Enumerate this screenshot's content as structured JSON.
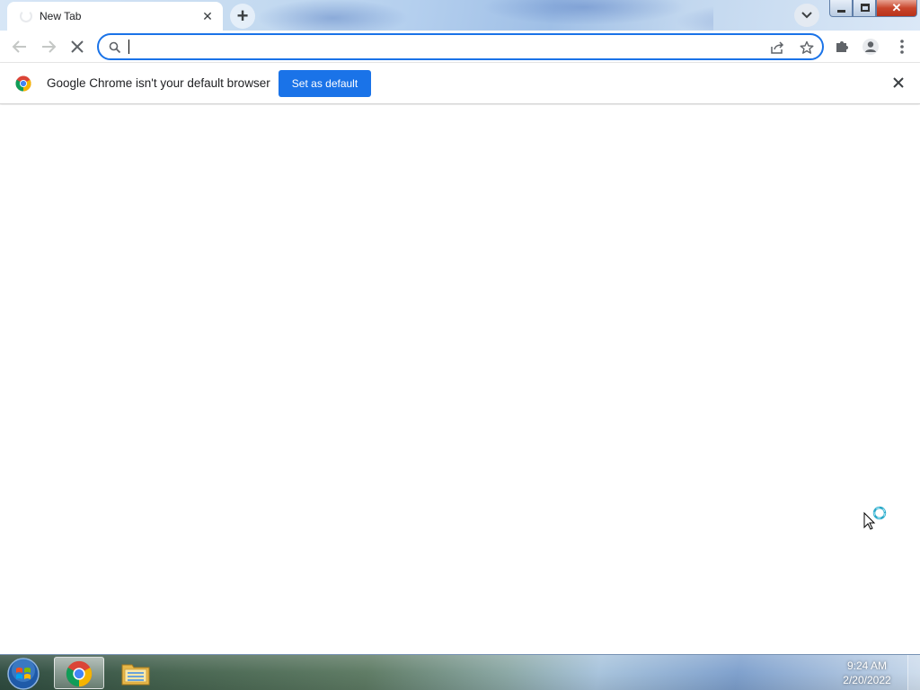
{
  "tab": {
    "title": "New Tab",
    "close_glyph": "✕"
  },
  "newtab": {
    "glyph": "+"
  },
  "window_controls": {
    "close_glyph": "✕"
  },
  "omnibox": {
    "value": "",
    "placeholder": ""
  },
  "infobar": {
    "message": "Google Chrome isn't your default browser",
    "button_label": "Set as default"
  },
  "taskbar": {
    "time": "9:24 AM",
    "date": "2/20/2022"
  },
  "colors": {
    "accent": "#1a73e8",
    "text": "#202124",
    "icon": "#5f6368"
  },
  "icons": [
    "search-icon",
    "share-icon",
    "bookmark-star-icon",
    "extensions-puzzle-icon",
    "profile-icon",
    "menu-kebab-icon",
    "back-arrow-icon",
    "forward-arrow-icon",
    "stop-loading-icon",
    "chrome-logo-icon",
    "close-icon",
    "windows-start-orb-icon",
    "file-explorer-icon",
    "busy-cursor-icon"
  ]
}
